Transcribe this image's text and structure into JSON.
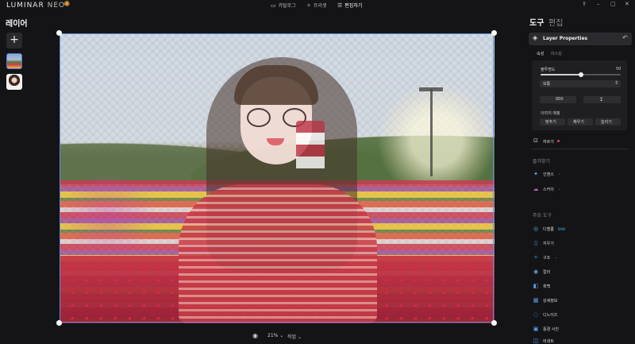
{
  "app": {
    "logo_text": "LUMINAR",
    "logo_suffix": "NEO",
    "nav_tabs": [
      {
        "label": "카탈로그",
        "icon": "folder-icon"
      },
      {
        "label": "프리셋",
        "icon": "sparkle-icon"
      },
      {
        "label": "편집하기",
        "icon": "sliders-icon"
      }
    ],
    "window_controls": [
      "⇪",
      "–",
      "▢",
      "✕"
    ]
  },
  "left_panel": {
    "title": "레이어",
    "add_label": "+",
    "layers": [
      "landscape-layer",
      "portrait-layer"
    ]
  },
  "status_bar": {
    "zoom": "21%",
    "view_mode": "작업"
  },
  "right_panel": {
    "tab_tools": "도구",
    "tab_edit": "편집",
    "layer_properties": {
      "title": "Layer Properties",
      "tabs": [
        "속성",
        "마스킹"
      ],
      "opacity_label": "불투명도",
      "opacity_value": "50",
      "opacity_fraction": 0.5,
      "blend_mode": "보통",
      "button_a": "000",
      "fit_label": "이미지 매핑",
      "fit_buttons": [
        "맞추기",
        "채우기",
        "늘리기"
      ]
    },
    "crop_label": "자르기",
    "favorites_title": "즐겨찾기",
    "favorites": [
      {
        "label": "인핸스",
        "icon": "enhance-icon",
        "color": "#4db6e8",
        "chevron": true
      },
      {
        "label": "스카이",
        "icon": "sky-icon",
        "color": "#c060d0",
        "chevron": true
      }
    ],
    "main_tools_title": "주요 도구",
    "main_tools": [
      {
        "label": "디벨롭",
        "icon": "develop-icon",
        "color": "#4db6e8",
        "suffix": "RAW"
      },
      {
        "label": "지우기",
        "icon": "eraser-icon",
        "color": "#5aa0e8"
      },
      {
        "label": "구조",
        "icon": "structure-icon",
        "color": "#5aa0e8",
        "chevron": true
      },
      {
        "label": "컬러",
        "icon": "color-icon",
        "color": "#5aa0e8"
      },
      {
        "label": "흑백",
        "icon": "bw-icon",
        "color": "#5aa0e8"
      },
      {
        "label": "상세정보",
        "icon": "details-icon",
        "color": "#5aa0e8"
      },
      {
        "label": "디노이즈",
        "icon": "denoise-icon",
        "color": "#5aa0e8"
      },
      {
        "label": "풍경 사진",
        "icon": "landscape-icon",
        "color": "#5aa0e8"
      },
      {
        "label": "비네트",
        "icon": "vignette-icon",
        "color": "#5aa0e8"
      }
    ]
  },
  "colors": {
    "accent": "#4a7cd8",
    "background": "#141416",
    "pink": "#e04060"
  }
}
